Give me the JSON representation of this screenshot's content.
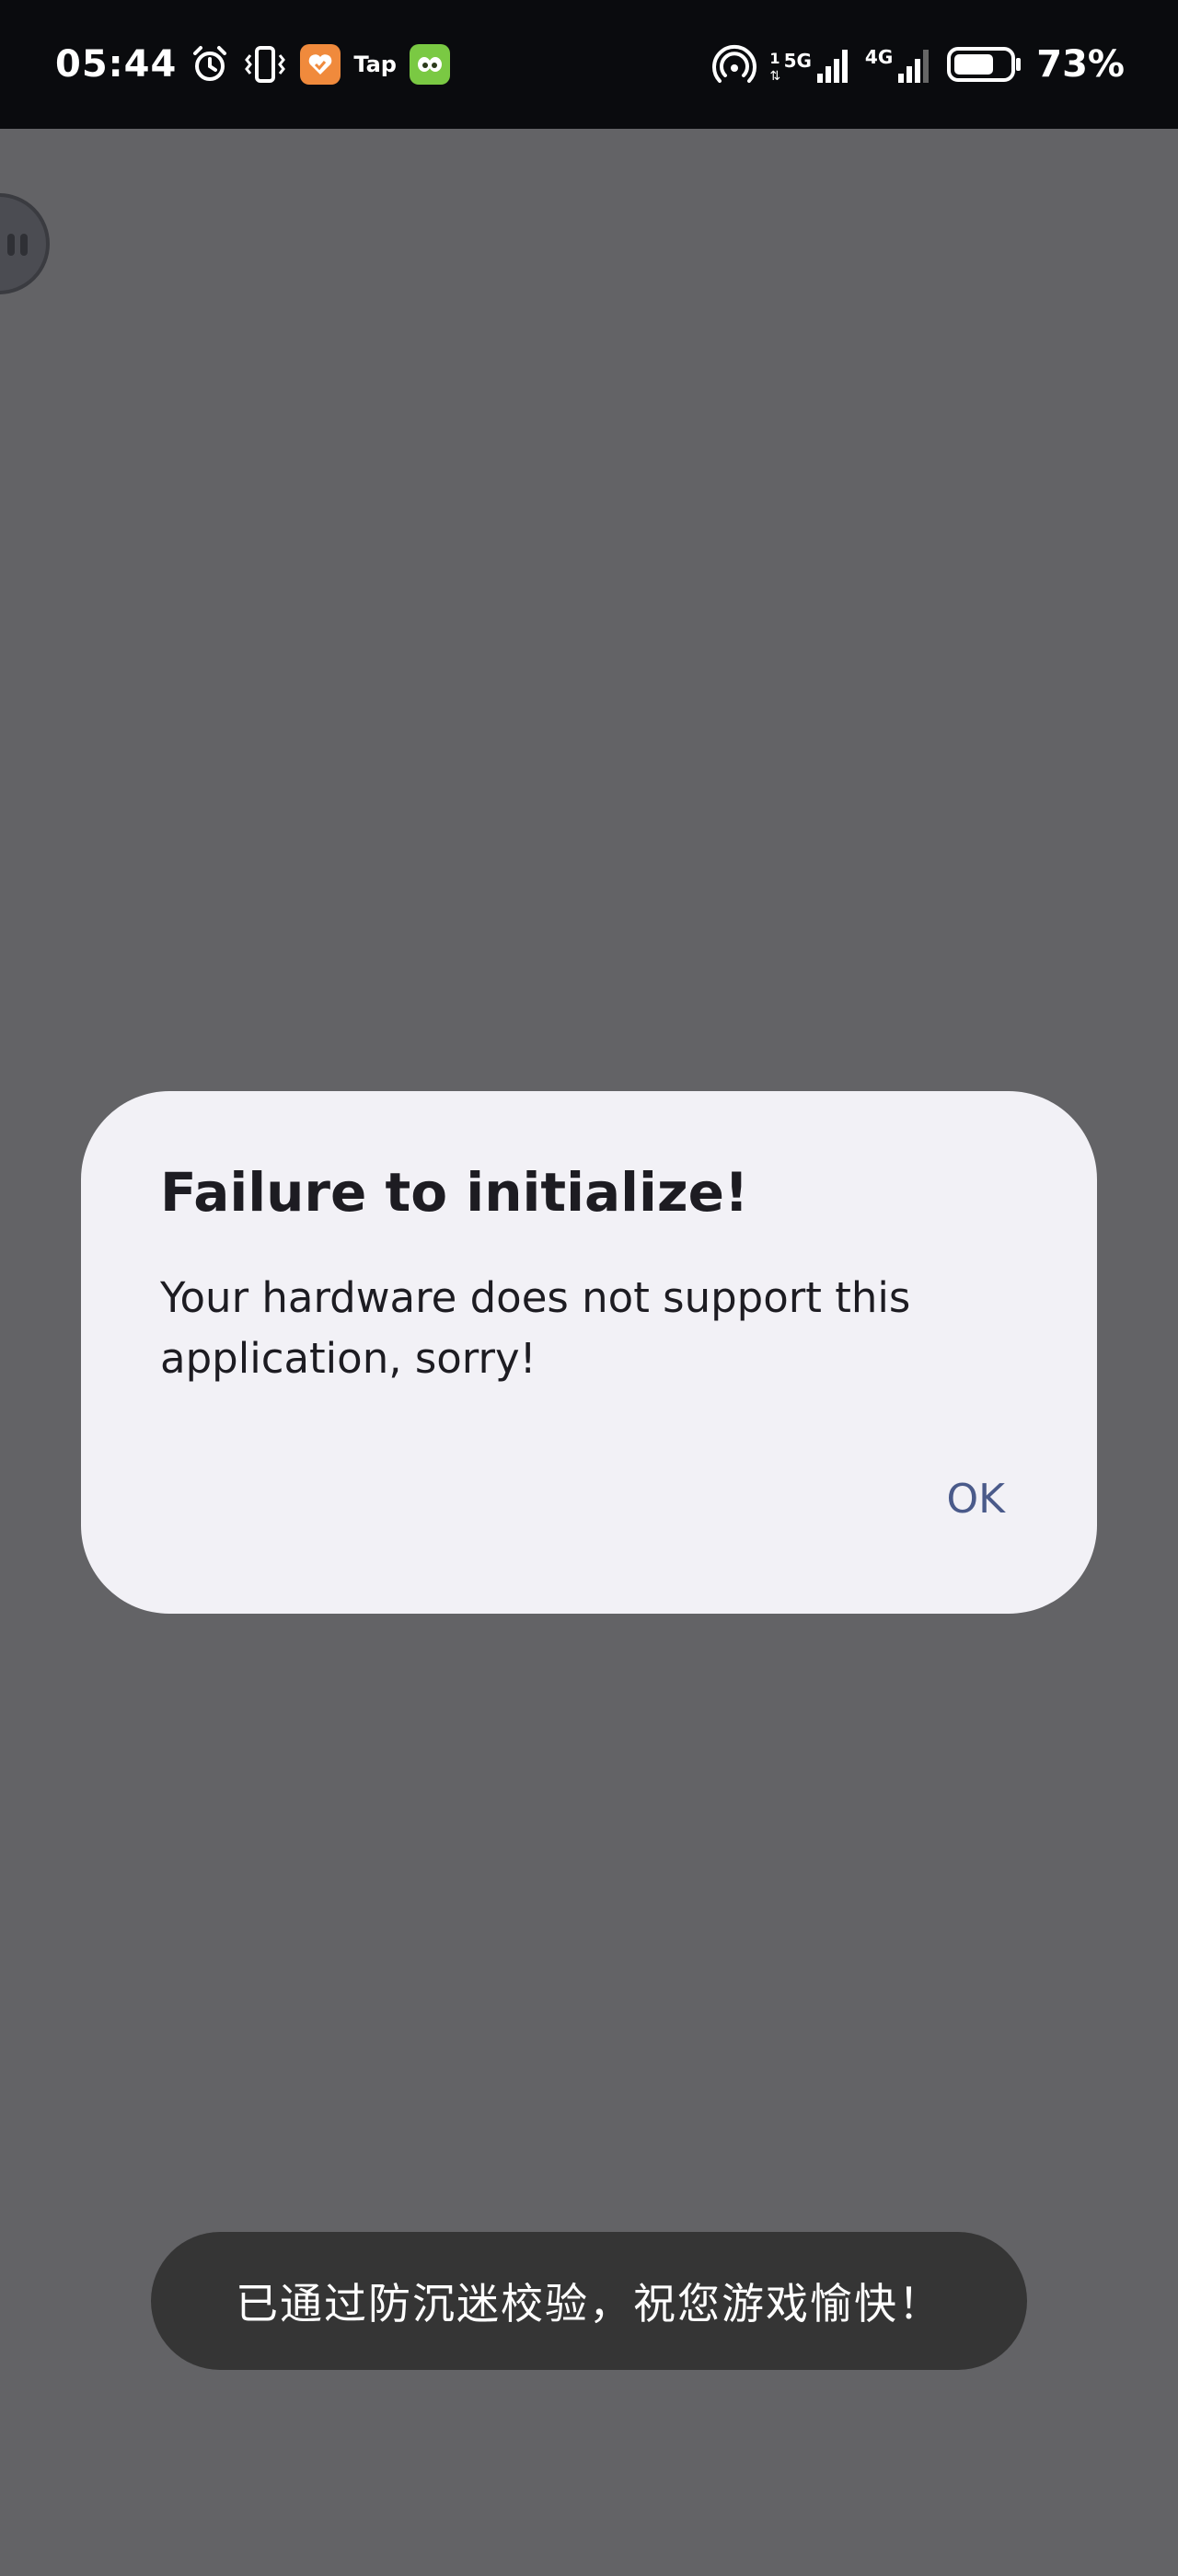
{
  "status_bar": {
    "time": "05:44",
    "app_icon_tap_label": "Tap",
    "network_primary": "5G",
    "network_primary_sim": "1",
    "network_secondary": "4G",
    "battery_percent": "73%",
    "battery_level": 0.73,
    "icons": [
      "alarm-icon",
      "vibrate-icon",
      "heart-app-icon",
      "tap-app-icon",
      "duolingo-app-icon",
      "hotspot-icon",
      "signal-icon",
      "battery-icon"
    ]
  },
  "dialog": {
    "title": "Failure to initialize!",
    "message": "Your hardware does not support this application, sorry!",
    "ok_label": "OK"
  },
  "toast": {
    "text": "已通过防沉迷校验，祝您游戏愉快！"
  },
  "colors": {
    "background": "#636366",
    "status_bar": "#0a0b0e",
    "dialog_bg": "#f2f1f6",
    "ok_accent": "#4a5a8a",
    "toast_bg": "#353535",
    "heart_app": "#f08a3c",
    "duolingo_app": "#7ac943"
  }
}
